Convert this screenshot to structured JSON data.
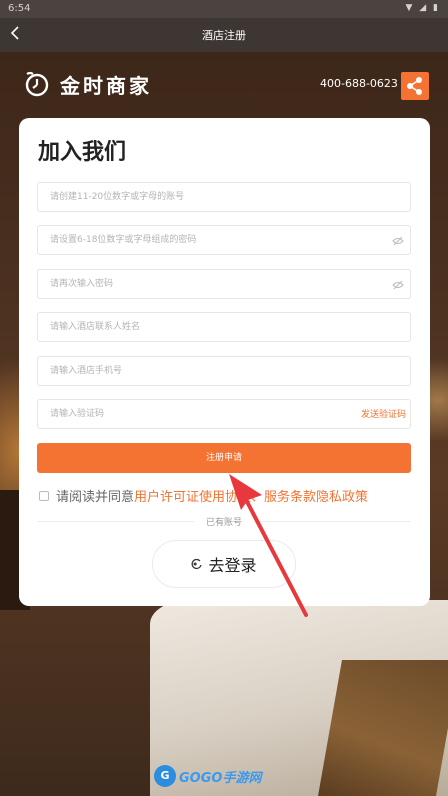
{
  "status_bar": {
    "time": "6:54",
    "icons": "▼ ◢ ▮"
  },
  "header": {
    "back_icon": "chevron-left-icon",
    "title": "酒店注册"
  },
  "brand": {
    "name": "金时商家",
    "logo_icon": "clock-logo-icon"
  },
  "contact": {
    "phone": "400-688-0623",
    "share_icon": "share-icon"
  },
  "form": {
    "title": "加入我们",
    "fields": [
      {
        "placeholder": "请创建11-20位数字或字母的账号",
        "value": ""
      },
      {
        "placeholder": "请设置6-18位数字或字母组成的密码",
        "value": "",
        "icon": "eye-off-icon"
      },
      {
        "placeholder": "请再次输入密码",
        "value": "",
        "icon": "eye-off-icon"
      },
      {
        "placeholder": "请输入酒店联系人姓名",
        "value": ""
      },
      {
        "placeholder": "请输入酒店手机号",
        "value": ""
      },
      {
        "placeholder": "请输入验证码",
        "value": ""
      }
    ],
    "send_code_label": "发送验证码",
    "submit_label": "注册申请",
    "agreement": {
      "prefix": "请阅读并同意",
      "link_text": "用户许可证使用协议、服务条款隐私政策",
      "checked": false
    },
    "divider_label": "已有账号",
    "login_label": "去登录"
  },
  "watermark": {
    "logo": "G",
    "text": "GOGO手游网"
  },
  "colors": {
    "accent": "#f47332",
    "titlebar": "#3d3633"
  }
}
